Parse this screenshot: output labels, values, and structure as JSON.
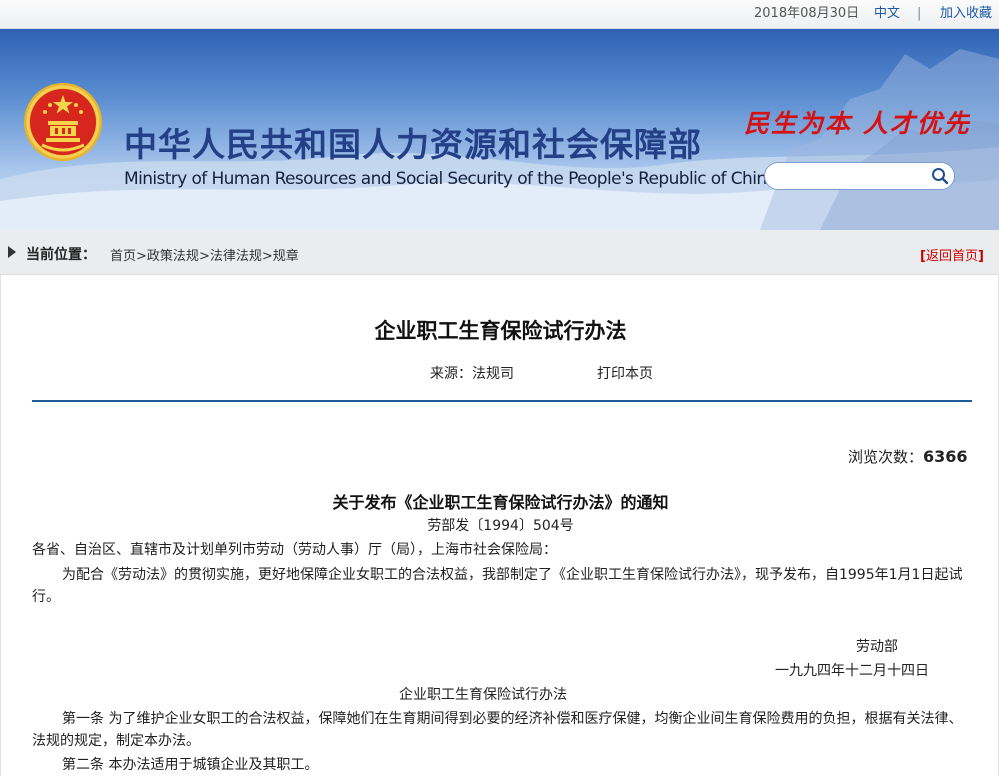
{
  "topbar": {
    "date": "2018年08月30日",
    "lang": "中文",
    "separator": "|",
    "favorite": "加入收藏"
  },
  "header": {
    "title_cn": "中华人民共和国人力资源和社会保障部",
    "title_en": "Ministry of Human Resources and Social Security of the People's Republic of China",
    "slogan": "民生为本  人才优先",
    "search_placeholder": "",
    "search_icon": "search-icon",
    "emblem_icon": "national-emblem-icon"
  },
  "breadcrumb": {
    "label": "当前位置：",
    "items": [
      "首页",
      "政策法规",
      "法律法规",
      "规章"
    ],
    "separator": ">",
    "back_open": "[",
    "back_label": "返回首页",
    "back_close": "]"
  },
  "article": {
    "title": "企业职工生育保险试行办法",
    "source": "来源：法规司",
    "print": "打印本页",
    "views_label": "浏览次数：",
    "views_count": "6366",
    "notice_title": "关于发布《企业职工生育保险试行办法》的通知",
    "doc_number": "劳部发〔1994〕504号",
    "recipients": "各省、自治区、直辖市及计划单列市劳动（劳动人事）厅（局），上海市社会保险局：",
    "para1": "为配合《劳动法》的贯彻实施，更好地保障企业女职工的合法权益，我部制定了《企业职工生育保险试行办法》，现予发布，自1995年1月1日起试行。",
    "signer": "劳动部",
    "sign_date": "一九九四年十二月十四日",
    "sub_title": "企业职工生育保险试行办法",
    "article1": "第一条 为了维护企业女职工的合法权益，保障她们在生育期间得到必要的经济补偿和医疗保健，均衡企业间生育保险费用的负担，根据有关法律、法规的规定，制定本办法。",
    "article2": "第二条 本办法适用于城镇企业及其职工。"
  },
  "colors": {
    "brand_blue": "#233f86",
    "link_blue": "#1c5aa6",
    "slogan_red": "#d41212",
    "divider_blue": "#1f5b9a"
  }
}
